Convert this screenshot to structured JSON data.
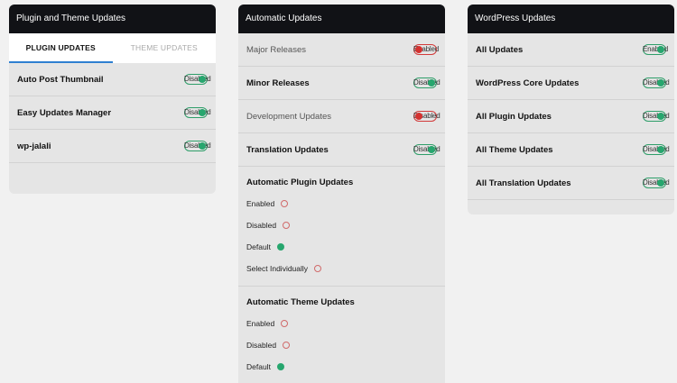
{
  "panels": {
    "plugin_theme": {
      "title": "Plugin and Theme Updates",
      "tabs": [
        {
          "label": "PLUGIN UPDATES"
        },
        {
          "label": "THEME UPDATES"
        }
      ],
      "rows": [
        {
          "label": "Auto Post Thumbnail",
          "status": "Disabled"
        },
        {
          "label": "Easy Updates Manager",
          "status": "Disabled"
        },
        {
          "label": "wp-jalali",
          "status": "Disabled"
        }
      ]
    },
    "automatic": {
      "title": "Automatic Updates",
      "rows": [
        {
          "label": "Major Releases",
          "status": "Enabled"
        },
        {
          "label": "Minor Releases",
          "status": "Disabled"
        },
        {
          "label": "Development Updates",
          "status": "Disabled"
        },
        {
          "label": "Translation Updates",
          "status": "Disabled"
        }
      ],
      "plugin_section": {
        "title": "Automatic Plugin Updates",
        "options": [
          "Enabled",
          "Disabled",
          "Default",
          "Select Individually"
        ]
      },
      "theme_section": {
        "title": "Automatic Theme Updates",
        "options": [
          "Enabled",
          "Disabled",
          "Default"
        ]
      }
    },
    "wordpress": {
      "title": "WordPress Updates",
      "rows": [
        {
          "label": "All Updates",
          "status": "Enabled"
        },
        {
          "label": "WordPress Core Updates",
          "status": "Disabled"
        },
        {
          "label": "All Plugin Updates",
          "status": "Disabled"
        },
        {
          "label": "All Theme Updates",
          "status": "Disabled"
        },
        {
          "label": "All Translation Updates",
          "status": "Disabled"
        }
      ]
    }
  },
  "colors": {
    "header_bg": "#111216",
    "panel_bg": "#e5e5e5",
    "toggle_green": "#27a66e",
    "toggle_red": "#d4312f",
    "tab_active_underline": "#2f80d1"
  }
}
